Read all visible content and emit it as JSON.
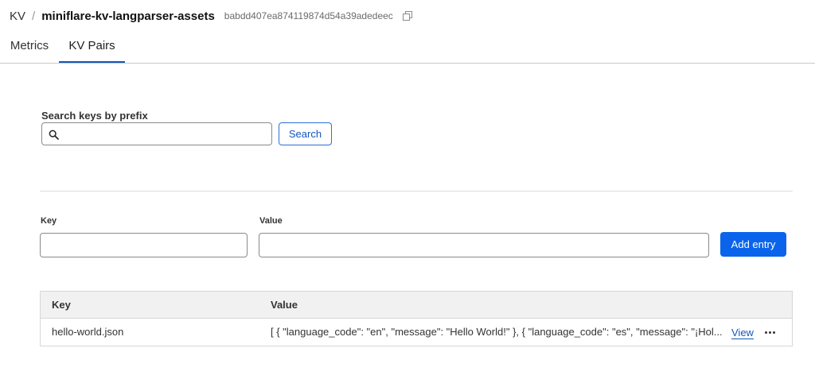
{
  "breadcrumb": {
    "root": "KV",
    "separator": "/",
    "namespace_name": "miniflare-kv-langparser-assets",
    "namespace_id": "babdd407ea874119874d54a39adedeec"
  },
  "tabs": [
    {
      "label": "Metrics",
      "active": false
    },
    {
      "label": "KV Pairs",
      "active": true
    }
  ],
  "search": {
    "label": "Search keys by prefix",
    "value": "",
    "button_label": "Search"
  },
  "entry_form": {
    "key_label": "Key",
    "value_label": "Value",
    "key_value": "",
    "value_value": "",
    "add_button_label": "Add entry"
  },
  "table": {
    "headers": [
      "Key",
      "Value"
    ],
    "rows": [
      {
        "key": "hello-world.json",
        "value": "[ { \"language_code\": \"en\", \"message\": \"Hello World!\" }, { \"language_code\": \"es\", \"message\": \"¡Hol...",
        "view_label": "View"
      }
    ]
  },
  "colors": {
    "accent": "#0a64eb",
    "link": "#1456bd",
    "header_bg": "#f1f1f1"
  },
  "icons": {
    "copy": "copy-icon",
    "search": "search-icon",
    "more": "more-options-icon"
  }
}
